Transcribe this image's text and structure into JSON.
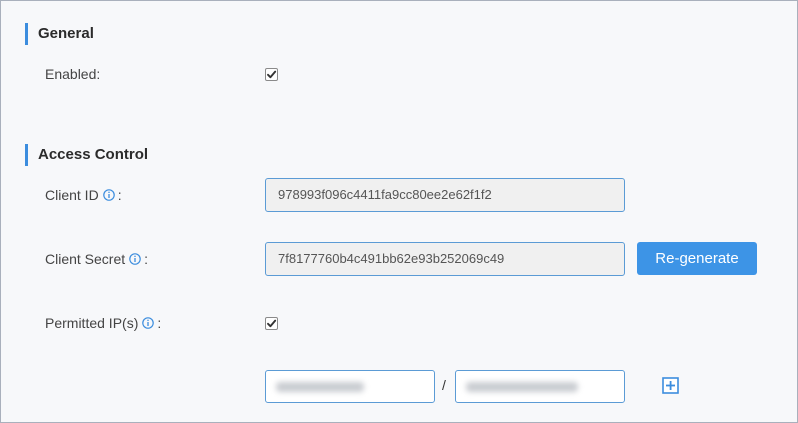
{
  "general": {
    "title": "General",
    "enabled_label": "Enabled:",
    "enabled_checked": true
  },
  "access_control": {
    "title": "Access Control",
    "client_id": {
      "label": "Client ID",
      "colon": ":",
      "value": "978993f096c4411fa9cc80ee2e62f1f2",
      "info_icon": "info-icon"
    },
    "client_secret": {
      "label": "Client Secret",
      "colon": ":",
      "value": "7f8177760b4c491bb62e93b252069c49",
      "info_icon": "info-icon",
      "regenerate_label": "Re-generate"
    },
    "permitted_ips": {
      "label": "Permitted IP(s)",
      "colon": ":",
      "checked": true,
      "info_icon": "info-icon",
      "separator": "/",
      "add_icon": "plus-square-icon"
    }
  },
  "colors": {
    "accent": "#3c8dde",
    "button": "#3d94e6",
    "field_border": "#5b9bd5",
    "background": "#f7f8fa"
  }
}
